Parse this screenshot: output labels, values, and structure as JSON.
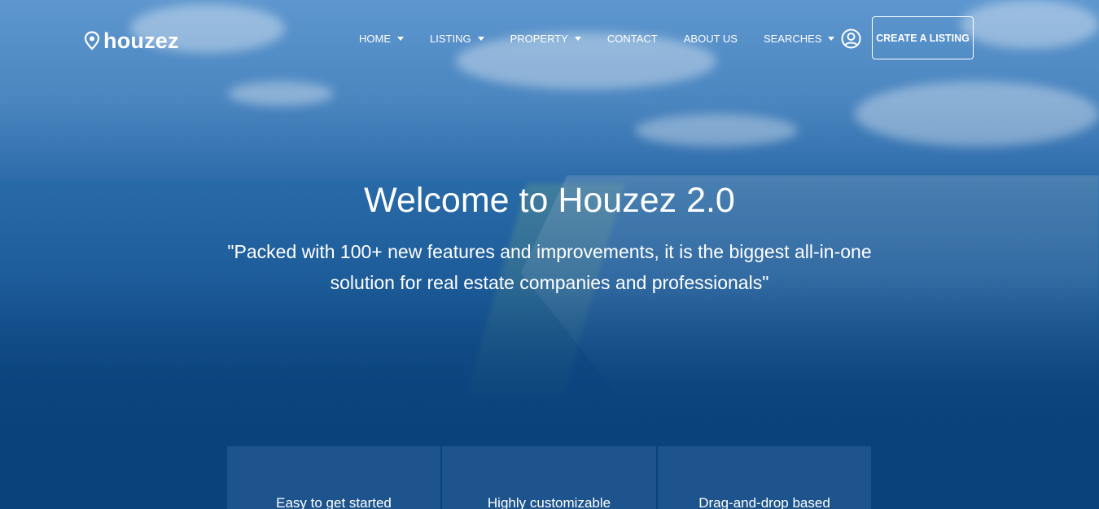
{
  "brand": {
    "name": "houzez",
    "icon": "map-pin-icon"
  },
  "nav": {
    "items": [
      {
        "label": "HOME",
        "has_dropdown": true
      },
      {
        "label": "LISTING",
        "has_dropdown": true
      },
      {
        "label": "PROPERTY",
        "has_dropdown": true
      },
      {
        "label": "CONTACT",
        "has_dropdown": false
      },
      {
        "label": "ABOUT US",
        "has_dropdown": false
      },
      {
        "label": "SEARCHES",
        "has_dropdown": true
      }
    ],
    "user_icon": "user-circle-icon",
    "cta_label": "CREATE A LISTING"
  },
  "hero": {
    "title": "Welcome to Houzez 2.0",
    "subtitle": "\"Packed with 100+ new features and improvements, it is the biggest all-in-one solution for real estate companies and professionals\""
  },
  "features": [
    {
      "label": "Easy to get started"
    },
    {
      "label": "Highly customizable"
    },
    {
      "label": "Drag-and-drop based"
    }
  ],
  "colors": {
    "primary": "#0d427c",
    "text": "#ffffff"
  }
}
